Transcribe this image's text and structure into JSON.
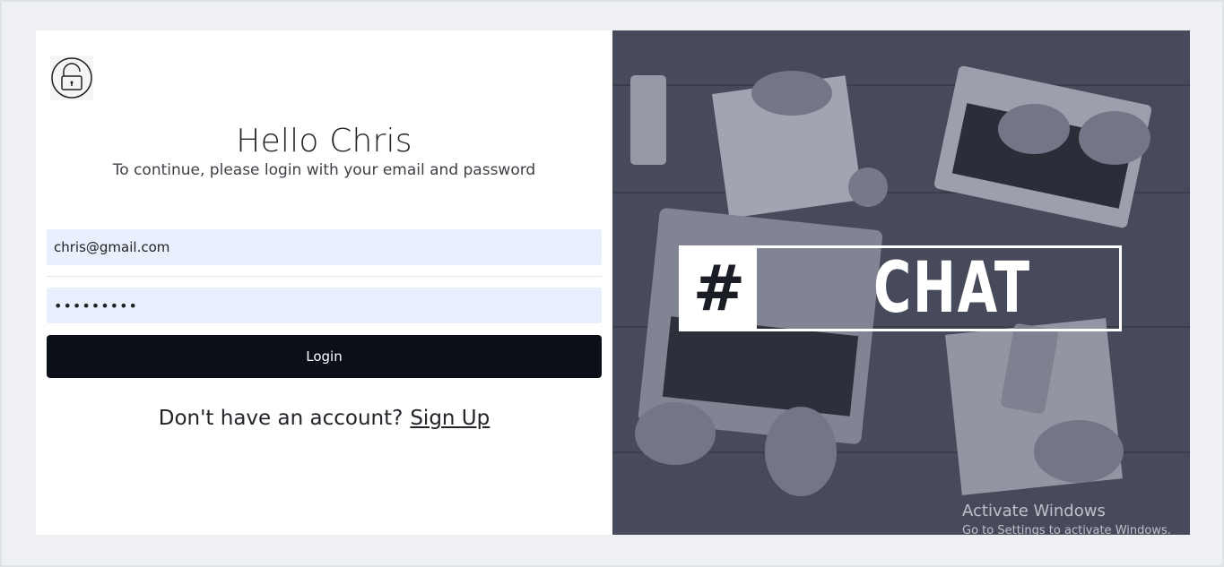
{
  "login": {
    "title": "Hello Chris",
    "subtitle": "To continue, please login with your email and password",
    "email_value": "chris@gmail.com",
    "password_mask": "•••••••••",
    "login_label": "Login",
    "signup_prompt": "Don't have an account?",
    "signup_link": "Sign Up",
    "icon": "lock-open-icon"
  },
  "banner": {
    "hash": "#",
    "brand": "CHAT"
  },
  "watermark": {
    "title": "Activate Windows",
    "subtitle": "Go to Settings to activate Windows."
  },
  "colors": {
    "page_bg": "#eef0f3",
    "input_bg": "#e8f0fe",
    "button_bg": "#0b0f17",
    "photo_tint": "#4a4e5e"
  }
}
